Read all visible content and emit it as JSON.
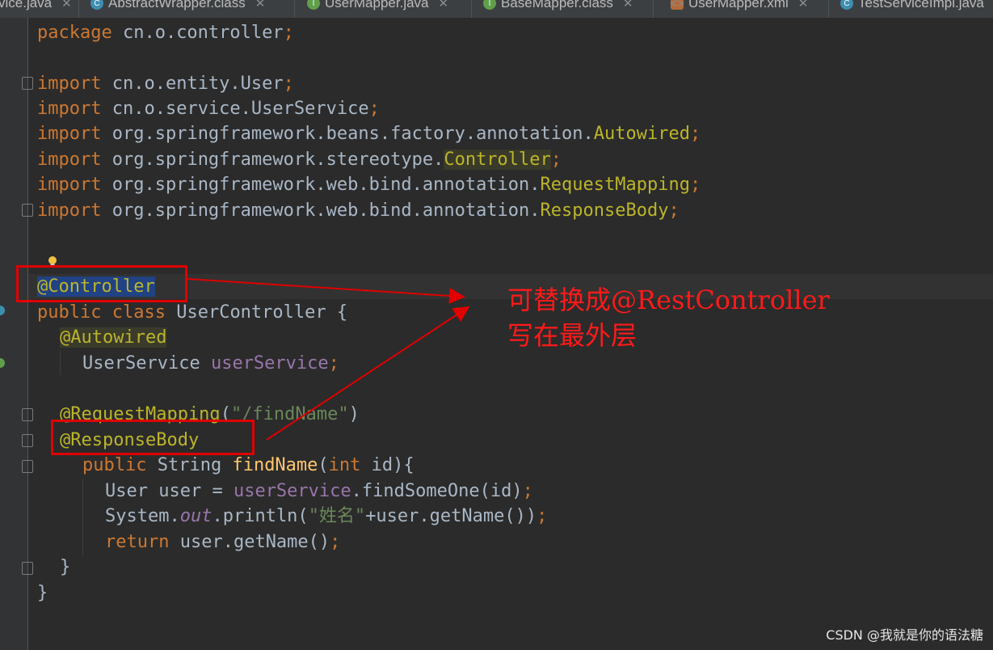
{
  "tabs": [
    {
      "label": "vice.java",
      "icon": "java-file-icon"
    },
    {
      "label": "AbstractWrapper.class",
      "icon": "class-icon"
    },
    {
      "label": "UserMapper.java",
      "icon": "interface-icon"
    },
    {
      "label": "BaseMapper.class",
      "icon": "interface-icon"
    },
    {
      "label": "UserMapper.xml",
      "icon": "xml-file-icon"
    },
    {
      "label": "TestServiceImpl.java",
      "icon": "class-icon"
    }
  ],
  "code": {
    "package": [
      "package",
      " cn.o.controller",
      ";"
    ],
    "imp1": [
      "import",
      " cn.o.entity.User",
      ";"
    ],
    "imp2": [
      "import",
      " cn.o.service.UserService",
      ";"
    ],
    "imp3": [
      "import",
      " org.springframework.beans.factory.annotation.",
      "Autowired",
      ";"
    ],
    "imp4": [
      "import",
      " org.springframework.stereotype.",
      "Controller",
      ";"
    ],
    "imp5": [
      "import",
      " org.springframework.web.bind.annotation.",
      "RequestMapping",
      ";"
    ],
    "imp6": [
      "import",
      " org.springframework.web.bind.annotation.",
      "ResponseBody",
      ";"
    ],
    "ctrl": "@Controller",
    "cls": [
      "public",
      " ",
      "class",
      " UserController {"
    ],
    "autowired": "@Autowired",
    "field": [
      "UserService ",
      "userService",
      ";"
    ],
    "reqmap": [
      "@RequestMapping",
      "(",
      "\"/findName\"",
      ")"
    ],
    "respbody": "@ResponseBody",
    "method": [
      "public",
      " String ",
      "findName",
      "(",
      "int",
      " id){"
    ],
    "l1": [
      "User user = ",
      "userService",
      ".findSomeOne(id)",
      ";"
    ],
    "l2": [
      "System.",
      "out",
      ".println(",
      "\"姓名\"",
      "+user.getName())",
      ";"
    ],
    "l3": [
      "return",
      " user.getName()",
      ";"
    ],
    "close1": "}",
    "close2": "}"
  },
  "annotation_note": {
    "line1": "可替换成@RestController",
    "line2": "写在最外层"
  },
  "watermark": "CSDN @我就是你的语法糖️",
  "colors": {
    "annotation_red": "#e00000",
    "keyword": "#cc7832",
    "annotation": "#bbb529",
    "string": "#6a8759"
  }
}
